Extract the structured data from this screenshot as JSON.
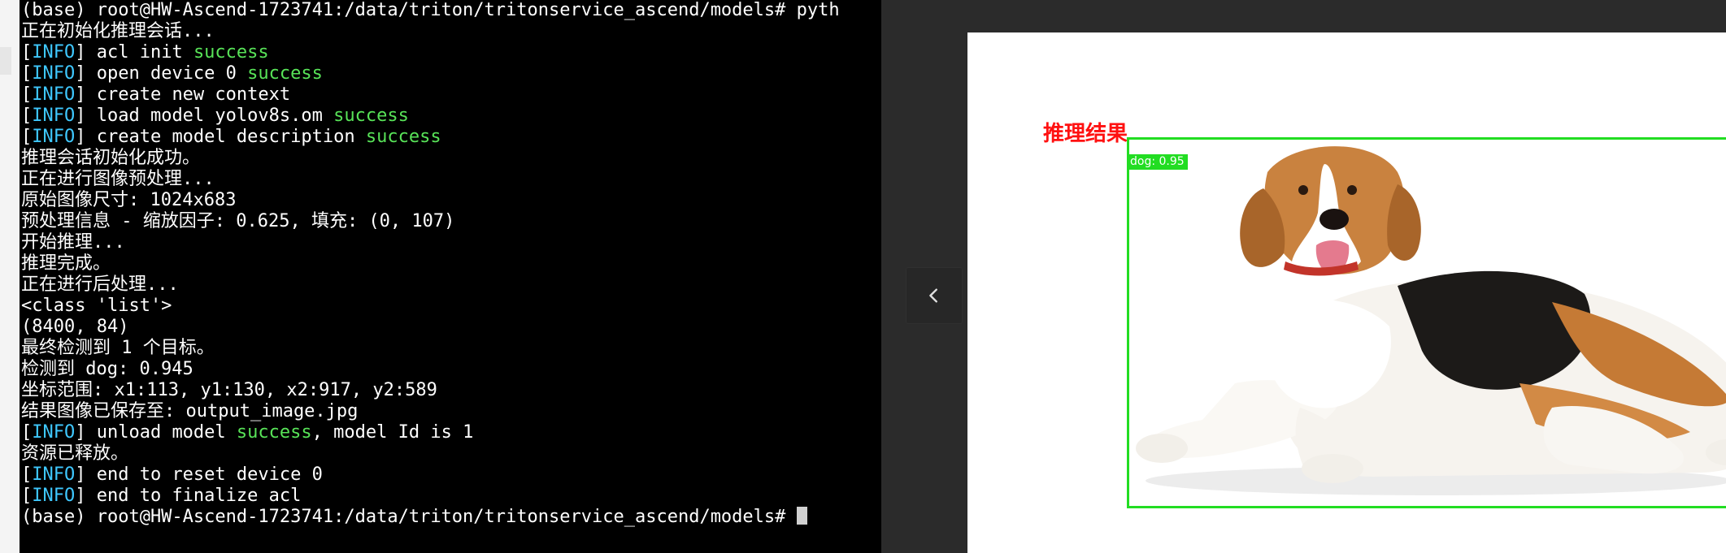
{
  "terminal": {
    "lines": [
      [
        {
          "t": "(base) root@HW-Ascend-1723741:/data/triton/tritonservice_ascend/models# pyth",
          "c": ""
        }
      ],
      [
        {
          "t": "正在初始化推理会话...",
          "c": ""
        }
      ],
      [
        {
          "t": "[",
          "c": ""
        },
        {
          "t": "INFO",
          "c": "c-info"
        },
        {
          "t": "] acl init ",
          "c": ""
        },
        {
          "t": "success",
          "c": "c-ok"
        }
      ],
      [
        {
          "t": "[",
          "c": ""
        },
        {
          "t": "INFO",
          "c": "c-info"
        },
        {
          "t": "] open device 0 ",
          "c": ""
        },
        {
          "t": "success",
          "c": "c-ok"
        }
      ],
      [
        {
          "t": "[",
          "c": ""
        },
        {
          "t": "INFO",
          "c": "c-info"
        },
        {
          "t": "] create new context",
          "c": ""
        }
      ],
      [
        {
          "t": "[",
          "c": ""
        },
        {
          "t": "INFO",
          "c": "c-info"
        },
        {
          "t": "] load model yolov8s.om ",
          "c": ""
        },
        {
          "t": "success",
          "c": "c-ok"
        }
      ],
      [
        {
          "t": "[",
          "c": ""
        },
        {
          "t": "INFO",
          "c": "c-info"
        },
        {
          "t": "] create model description ",
          "c": ""
        },
        {
          "t": "success",
          "c": "c-ok"
        }
      ],
      [
        {
          "t": "推理会话初始化成功。",
          "c": ""
        }
      ],
      [
        {
          "t": "正在进行图像预处理...",
          "c": ""
        }
      ],
      [
        {
          "t": "原始图像尺寸: 1024x683",
          "c": ""
        }
      ],
      [
        {
          "t": "预处理信息 - 缩放因子: 0.625, 填充: (0, 107)",
          "c": ""
        }
      ],
      [
        {
          "t": "开始推理...",
          "c": ""
        }
      ],
      [
        {
          "t": "推理完成。",
          "c": ""
        }
      ],
      [
        {
          "t": "正在进行后处理...",
          "c": ""
        }
      ],
      [
        {
          "t": "<class 'list'>",
          "c": ""
        }
      ],
      [
        {
          "t": "(8400, 84)",
          "c": ""
        }
      ],
      [
        {
          "t": "最终检测到 1 个目标。",
          "c": ""
        }
      ],
      [
        {
          "t": "检测到 dog: 0.945",
          "c": ""
        }
      ],
      [
        {
          "t": "坐标范围: x1:113, y1:130, x2:917, y2:589",
          "c": ""
        }
      ],
      [
        {
          "t": "结果图像已保存至: output_image.jpg",
          "c": ""
        }
      ],
      [
        {
          "t": "[",
          "c": ""
        },
        {
          "t": "INFO",
          "c": "c-info"
        },
        {
          "t": "] unload model ",
          "c": ""
        },
        {
          "t": "success",
          "c": "c-ok"
        },
        {
          "t": ", model Id is 1",
          "c": ""
        }
      ],
      [
        {
          "t": "资源已释放。",
          "c": ""
        }
      ],
      [
        {
          "t": "[",
          "c": ""
        },
        {
          "t": "INFO",
          "c": "c-info"
        },
        {
          "t": "] end to reset device 0",
          "c": ""
        }
      ],
      [
        {
          "t": "[",
          "c": ""
        },
        {
          "t": "INFO",
          "c": "c-info"
        },
        {
          "t": "] end to finalize acl",
          "c": ""
        }
      ]
    ],
    "prompt": "(base) root@HW-Ascend-1723741:/data/triton/tritonservice_ascend/models# "
  },
  "viewer": {
    "nav_prev_icon": "chevron-left-icon",
    "result_title": "推理结果",
    "detection_label": "dog: 0.95"
  },
  "colors": {
    "terminal_bg": "#000000",
    "info": "#3fc8ff",
    "success": "#58e358",
    "bbox": "#22dd22",
    "title": "#ff1111"
  }
}
